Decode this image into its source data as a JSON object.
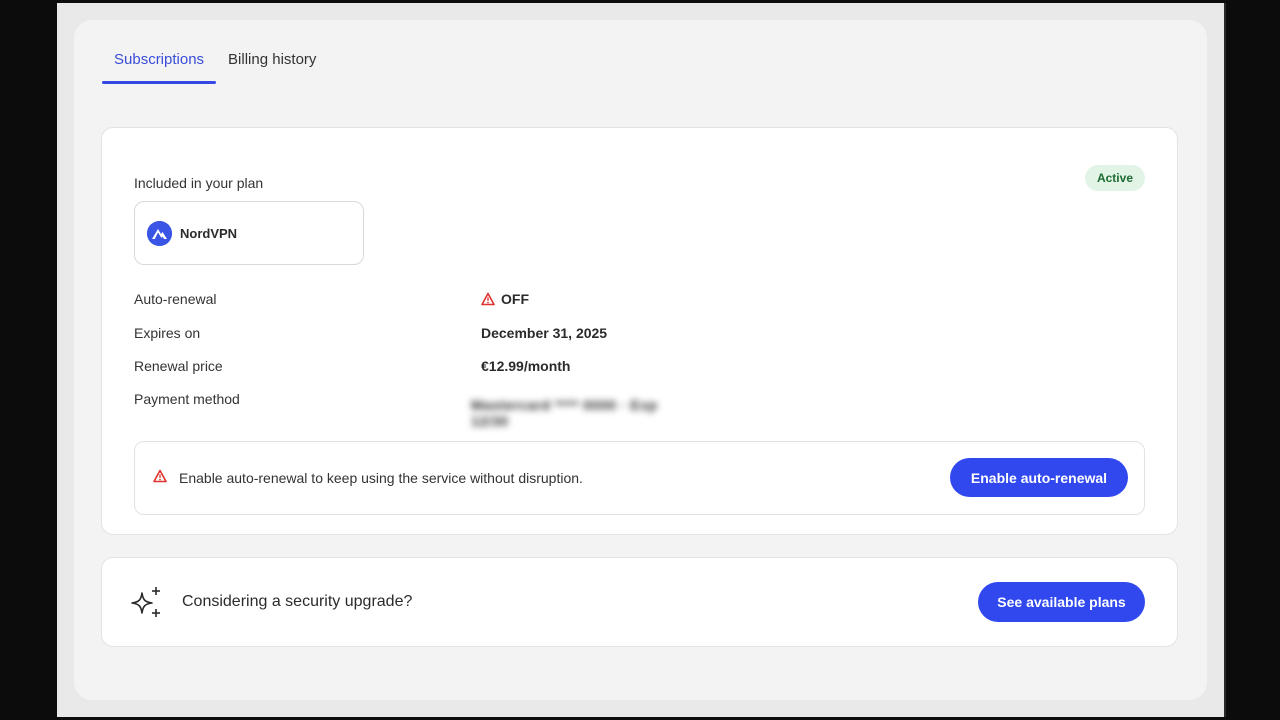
{
  "tabs": [
    {
      "label": "Subscriptions",
      "active": true
    },
    {
      "label": "Billing history",
      "active": false
    }
  ],
  "plan": {
    "included_label": "Included in your plan",
    "status": "Active",
    "product_name": "NordVPN",
    "details": [
      {
        "label": "Auto-renewal",
        "value": "OFF",
        "warning": true
      },
      {
        "label": "Expires on",
        "value": "December 31, 2025"
      },
      {
        "label": "Renewal price",
        "value": "€12.99/month"
      },
      {
        "label": "Payment method",
        "value": "Mastercard **** 0000 · Exp 12/30",
        "blurred": true
      }
    ],
    "notice_text": "Enable auto-renewal to keep using the service without disruption.",
    "enable_button": "Enable auto-renewal"
  },
  "upsell": {
    "text": "Considering a security upgrade?",
    "button": "See available plans"
  },
  "colors": {
    "accent": "#3148ef",
    "badge_bg": "#e2f4e6",
    "badge_text": "#1d6b33",
    "warning": "#e0322e"
  },
  "icons": {
    "product": "nordvpn-mountain-icon",
    "warning": "warning-triangle-icon",
    "upsell": "sparkle-icon"
  }
}
